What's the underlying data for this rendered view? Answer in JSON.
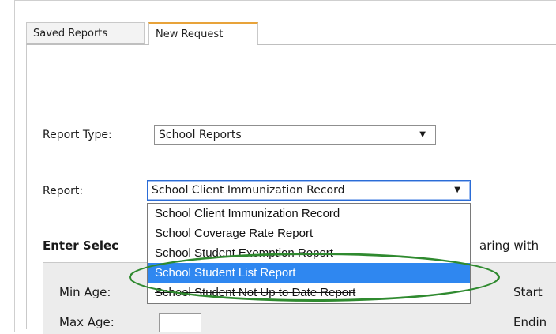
{
  "tabs": {
    "saved": "Saved Reports",
    "new": "New Request"
  },
  "form": {
    "report_type_label": "Report Type:",
    "report_type_value": "School Reports",
    "report_label": "Report:",
    "report_value": "School Client Immunization Record",
    "dropdown_options": [
      "School Client Immunization Record",
      "School Coverage Rate Report",
      "School Student Exemption Report",
      "School Student List Report",
      "School Student Not Up to Date Report"
    ],
    "selected_index": 3,
    "enter_selection_partial": "Enter Selec",
    "appearing_partial": "aring with",
    "min_age_label": "Min Age:",
    "max_age_label": "Max Age:",
    "start_partial": "Start",
    "ending_partial": "Endin"
  },
  "colors": {
    "tab_accent": "#e8a33a",
    "selected_option_bg": "#2f87f0",
    "highlight_ring": "#2f8a2f"
  }
}
